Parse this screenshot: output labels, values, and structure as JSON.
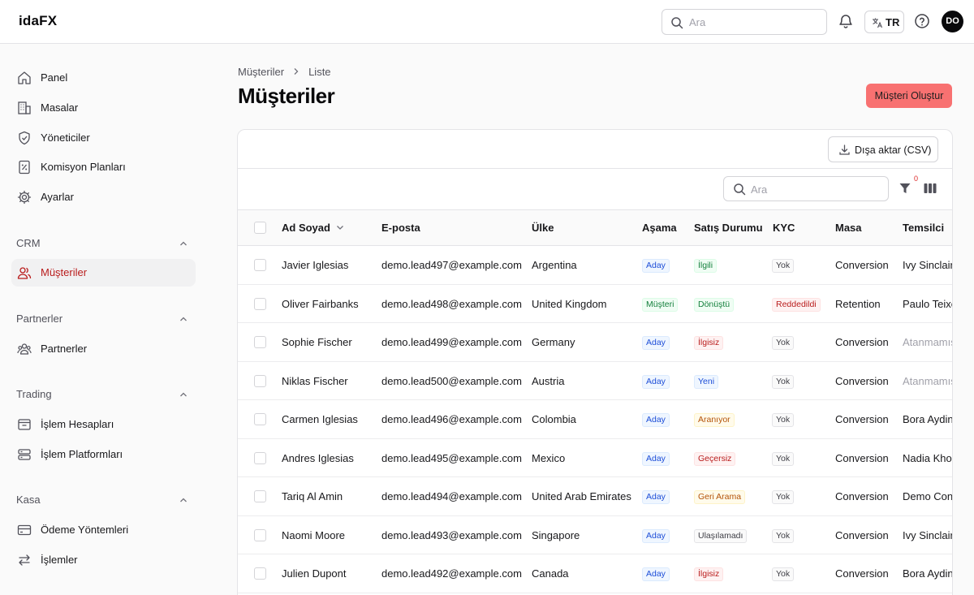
{
  "app": {
    "logo": "idaFX"
  },
  "header": {
    "search_placeholder": "Ara",
    "language": "TR",
    "avatar_initials": "DO"
  },
  "sidebar": {
    "items": [
      {
        "label": "Panel",
        "icon": "home-icon"
      },
      {
        "label": "Masalar",
        "icon": "building-icon"
      },
      {
        "label": "Yöneticiler",
        "icon": "shield-icon"
      },
      {
        "label": "Komisyon Planları",
        "icon": "percent-doc-icon"
      },
      {
        "label": "Ayarlar",
        "icon": "gear-icon"
      }
    ],
    "sections": [
      {
        "label": "CRM",
        "items": [
          {
            "label": "Müşteriler",
            "icon": "users-icon",
            "active": true
          }
        ]
      },
      {
        "label": "Partnerler",
        "items": [
          {
            "label": "Partnerler",
            "icon": "group-icon"
          }
        ]
      },
      {
        "label": "Trading",
        "items": [
          {
            "label": "İşlem Hesapları",
            "icon": "wallet-icon"
          },
          {
            "label": "İşlem Platformları",
            "icon": "server-icon"
          }
        ]
      },
      {
        "label": "Kasa",
        "items": [
          {
            "label": "Ödeme Yöntemleri",
            "icon": "credit-card-icon"
          },
          {
            "label": "İşlemler",
            "icon": "arrows-swap-icon"
          }
        ]
      }
    ]
  },
  "page": {
    "breadcrumb": [
      "Müşteriler",
      "Liste"
    ],
    "title": "Müşteriler",
    "create_button": "Müşteri Oluştur",
    "export_button": "Dışa aktar (CSV)",
    "table_search_placeholder": "Ara",
    "filter_count": "0"
  },
  "table": {
    "columns": [
      "Ad Soyad",
      "E-posta",
      "Ülke",
      "Aşama",
      "Satış Durumu",
      "KYC",
      "Masa",
      "Temsilci"
    ],
    "rows": [
      {
        "name": "Javier Iglesias",
        "email": "demo.lead497@example.com",
        "country": "Argentina",
        "stage": "Aday",
        "stage_color": "blue",
        "sales": "İlgili",
        "sales_color": "green",
        "kyc": "Yok",
        "kyc_color": "gray",
        "desk": "Conversion",
        "rep": "Ivy Sinclair",
        "rep_muted": false
      },
      {
        "name": "Oliver Fairbanks",
        "email": "demo.lead498@example.com",
        "country": "United Kingdom",
        "stage": "Müşteri",
        "stage_color": "green",
        "sales": "Dönüştü",
        "sales_color": "green",
        "kyc": "Reddedildi",
        "kyc_color": "red",
        "desk": "Retention",
        "rep": "Paulo Teixeira",
        "rep_muted": false
      },
      {
        "name": "Sophie Fischer",
        "email": "demo.lead499@example.com",
        "country": "Germany",
        "stage": "Aday",
        "stage_color": "blue",
        "sales": "İlgisiz",
        "sales_color": "red",
        "kyc": "Yok",
        "kyc_color": "gray",
        "desk": "Conversion",
        "rep": "Atanmamış",
        "rep_muted": true
      },
      {
        "name": "Niklas Fischer",
        "email": "demo.lead500@example.com",
        "country": "Austria",
        "stage": "Aday",
        "stage_color": "blue",
        "sales": "Yeni",
        "sales_color": "blue",
        "kyc": "Yok",
        "kyc_color": "gray",
        "desk": "Conversion",
        "rep": "Atanmamış",
        "rep_muted": true
      },
      {
        "name": "Carmen Iglesias",
        "email": "demo.lead496@example.com",
        "country": "Colombia",
        "stage": "Aday",
        "stage_color": "blue",
        "sales": "Aranıyor",
        "sales_color": "orange",
        "kyc": "Yok",
        "kyc_color": "gray",
        "desk": "Conversion",
        "rep": "Bora Aydin",
        "rep_muted": false
      },
      {
        "name": "Andres Iglesias",
        "email": "demo.lead495@example.com",
        "country": "Mexico",
        "stage": "Aday",
        "stage_color": "blue",
        "sales": "Geçersiz",
        "sales_color": "red",
        "kyc": "Yok",
        "kyc_color": "gray",
        "desk": "Conversion",
        "rep": "Nadia Khoury",
        "rep_muted": false
      },
      {
        "name": "Tariq Al Amin",
        "email": "demo.lead494@example.com",
        "country": "United Arab Emirates",
        "stage": "Aday",
        "stage_color": "blue",
        "sales": "Geri Arama",
        "sales_color": "orange",
        "kyc": "Yok",
        "kyc_color": "gray",
        "desk": "Conversion",
        "rep": "Demo Conversion",
        "rep_muted": false
      },
      {
        "name": "Naomi Moore",
        "email": "demo.lead493@example.com",
        "country": "Singapore",
        "stage": "Aday",
        "stage_color": "blue",
        "sales": "Ulaşılamadı",
        "sales_color": "gray",
        "kyc": "Yok",
        "kyc_color": "gray",
        "desk": "Conversion",
        "rep": "Ivy Sinclair",
        "rep_muted": false
      },
      {
        "name": "Julien Dupont",
        "email": "demo.lead492@example.com",
        "country": "Canada",
        "stage": "Aday",
        "stage_color": "blue",
        "sales": "İlgisiz",
        "sales_color": "red",
        "kyc": "Yok",
        "kyc_color": "gray",
        "desk": "Conversion",
        "rep": "Bora Aydin",
        "rep_muted": false
      }
    ]
  }
}
